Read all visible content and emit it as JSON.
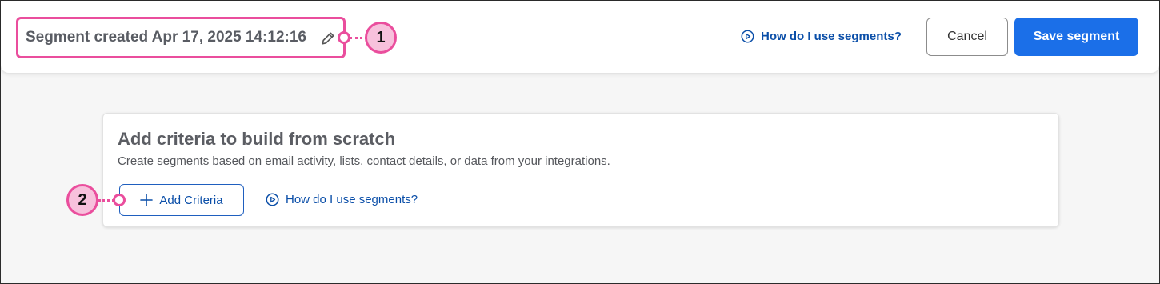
{
  "header": {
    "segment_title": "Segment created Apr 17, 2025 14:12:16",
    "help_link": "How do I use segments?",
    "cancel_label": "Cancel",
    "save_label": "Save segment"
  },
  "callouts": {
    "first": "1",
    "second": "2"
  },
  "builder": {
    "title": "Add criteria to build from scratch",
    "description": "Create segments based on email activity, lists, contact details, or data from your integrations.",
    "add_label": "Add Criteria",
    "help_link": "How do I use segments?"
  },
  "icons": {
    "edit": "pencil-icon",
    "help": "play-circle-icon",
    "add": "plus-icon"
  },
  "colors": {
    "primary": "#1b6fe8",
    "link": "#0a4ea8",
    "callout": "#ea4e9d",
    "callout_fill": "#f7c1dc"
  }
}
